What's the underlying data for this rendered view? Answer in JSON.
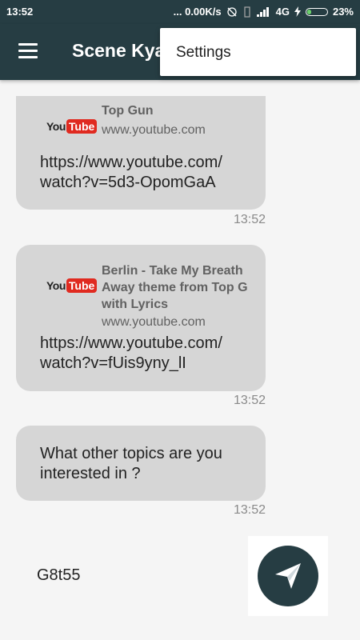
{
  "status_bar": {
    "time": "13:52",
    "speed": "... 0.00K/s",
    "network": "4G",
    "battery": "23%"
  },
  "app_bar": {
    "title": "Scene Kyal",
    "menu_icon": "hamburger-menu-icon"
  },
  "overflow_menu": {
    "items": [
      {
        "label": "Settings"
      }
    ]
  },
  "messages": [
    {
      "preview": {
        "logo_you": "You",
        "logo_tube": "Tube",
        "title": "Top Gun",
        "domain": "www.youtube.com"
      },
      "text": "https://www.youtube.com/\nwatch?v=5d3-OpomGaA",
      "time": "13:52"
    },
    {
      "preview": {
        "logo_you": "You",
        "logo_tube": "Tube",
        "title": "Berlin - Take My Breath\nAway theme from Top G\nwith Lyrics",
        "domain": "www.youtube.com"
      },
      "text": "https://www.youtube.com/\nwatch?v=fUis9yny_lI",
      "time": "13:52"
    },
    {
      "text": "What other topics are you\ninterested in ?",
      "time": "13:52"
    }
  ],
  "composer": {
    "input_value": "G8t55",
    "send_icon": "paper-plane-send-icon"
  },
  "colors": {
    "primary": "#263d43",
    "bubble": "#d6d6d6",
    "background": "#f5f5f5"
  }
}
